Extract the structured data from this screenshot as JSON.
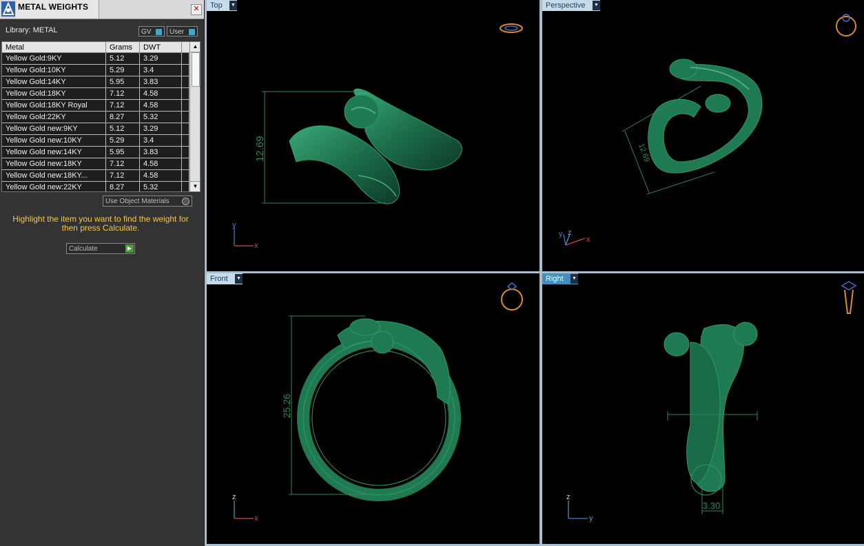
{
  "panel": {
    "title": "METAL WEIGHTS",
    "close_glyph": "✕",
    "library_label": "Library: METAL",
    "gv_label": "GV",
    "user_label": "User",
    "use_object_materials": "Use Object Materials",
    "instructions": "Highlight the item you want to find the weight for then press Calculate.",
    "calculate_label": "Calculate"
  },
  "table": {
    "columns": [
      "Metal",
      "Grams",
      "DWT"
    ],
    "rows": [
      [
        "Yellow Gold:9KY",
        "5.12",
        "3.29"
      ],
      [
        "Yellow Gold:10KY",
        "5.29",
        "3.4"
      ],
      [
        "Yellow Gold:14KY",
        "5.95",
        "3.83"
      ],
      [
        "Yellow Gold:18KY",
        "7.12",
        "4.58"
      ],
      [
        "Yellow Gold:18KY Royal",
        "7.12",
        "4.58"
      ],
      [
        "Yellow Gold:22KY",
        "8.27",
        "5.32"
      ],
      [
        "Yellow Gold new:9KY",
        "5.12",
        "3.29"
      ],
      [
        "Yellow Gold new:10KY",
        "5.29",
        "3.4"
      ],
      [
        "Yellow Gold new:14KY",
        "5.95",
        "3.83"
      ],
      [
        "Yellow Gold new:18KY",
        "7.12",
        "4.58"
      ],
      [
        "Yellow Gold new:18KY...",
        "7.12",
        "4.58"
      ],
      [
        "Yellow Gold new:22KY",
        "8.27",
        "5.32"
      ]
    ]
  },
  "viewports": {
    "top": {
      "label": "Top",
      "dimension": "12.69",
      "axis_h": "x",
      "axis_v": "y",
      "active": false
    },
    "perspective": {
      "label": "Perspective",
      "dimension": "12.69",
      "axis_a": "y",
      "axis_b": "z",
      "axis_c": "x",
      "active": false
    },
    "front": {
      "label": "Front",
      "dimension": "25.26",
      "axis_h": "x",
      "axis_v": "z",
      "active": false
    },
    "right": {
      "label": "Right",
      "dimension": "3.30",
      "axis_h": "y",
      "axis_v": "z",
      "active": true
    }
  },
  "colors": {
    "ring_green": "#1f7a52",
    "dimension_green": "#2c8a52",
    "instruction_yellow": "#f5c842",
    "active_viewport_label": "#3f8fc2"
  },
  "icons": [
    "app-logo-icon",
    "close-icon",
    "dropdown-arrow-icon",
    "scroll-up-icon",
    "scroll-down-icon",
    "play-icon",
    "ring-view-icon"
  ]
}
